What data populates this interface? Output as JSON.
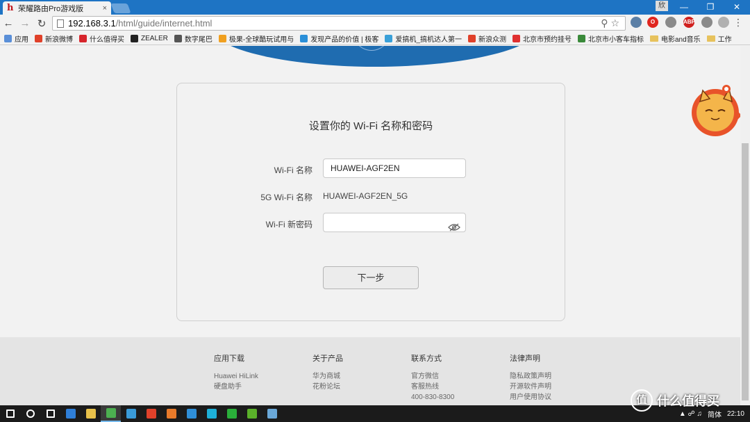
{
  "browser": {
    "tab_title": "荣耀路由Pro游戏版",
    "tab_close": "×",
    "profile_label": "欣",
    "window_controls": [
      "—",
      "❐",
      "✕"
    ],
    "url_host": "192.168.3.1",
    "url_path": "/html/guide/internet.html",
    "extensions": [
      {
        "name": "ext-translate",
        "label": "",
        "color": "#5b7fa6"
      },
      {
        "name": "ext-opera",
        "label": "O",
        "color": "#e0261f"
      },
      {
        "name": "ext-chrome",
        "label": "",
        "color": "#8a8a8a"
      },
      {
        "name": "ext-abp",
        "label": "ABP",
        "color": "#d0201e"
      },
      {
        "name": "ext-gray",
        "label": "",
        "color": "#8a8a8a"
      },
      {
        "name": "ext-feather",
        "label": "",
        "color": "#b0b0b0"
      }
    ]
  },
  "bookmarks": [
    {
      "label": "应用",
      "color": "#5a8fd8"
    },
    {
      "label": "新浪微博",
      "color": "#e0412a"
    },
    {
      "label": "什么值得买",
      "color": "#d7252c"
    },
    {
      "label": "ZEALER",
      "color": "#222222"
    },
    {
      "label": "数字尾巴",
      "color": "#555555"
    },
    {
      "label": "极果-全球酷玩试用与",
      "color": "#f0a020"
    },
    {
      "label": "发现产品的价值 | 极客",
      "color": "#2a8fd8"
    },
    {
      "label": "爱搞机_搞机达人第一",
      "color": "#3aa0d8"
    },
    {
      "label": "新浪众测",
      "color": "#e0412a"
    },
    {
      "label": "北京市预约挂号",
      "color": "#e03030"
    },
    {
      "label": "北京市小客车指标",
      "color": "#3a8a3a"
    },
    {
      "label": "电影and音乐",
      "color": "folder"
    },
    {
      "label": "工作",
      "color": "folder"
    }
  ],
  "form": {
    "title": "设置你的 Wi-Fi 名称和密码",
    "wifi_name_label": "Wi-Fi 名称",
    "wifi_name_value": "HUAWEI-AGF2EN",
    "wifi5g_label": "5G Wi-Fi 名称",
    "wifi5g_value": "HUAWEI-AGF2EN_5G",
    "password_label": "Wi-Fi 新密码",
    "password_value": "",
    "next_button": "下一步"
  },
  "footer": [
    {
      "heading": "应用下载",
      "links": [
        "Huawei HiLink",
        "硬盘助手"
      ]
    },
    {
      "heading": "关于产品",
      "links": [
        "华为商城",
        "花粉论坛"
      ]
    },
    {
      "heading": "联系方式",
      "links": [
        "官方微信",
        "客服热线",
        "400-830-8300"
      ]
    },
    {
      "heading": "法律声明",
      "links": [
        "隐私政策声明",
        "开源软件声明",
        "用户使用协议"
      ]
    }
  ],
  "taskbar": {
    "ime_label": "简体",
    "clock": "22:10",
    "apps": [
      {
        "name": "start-icon",
        "color": "#ffffff"
      },
      {
        "name": "search-icon",
        "color": "#ffffff"
      },
      {
        "name": "task-view-icon",
        "color": "#ffffff"
      },
      {
        "name": "edge-icon",
        "color": "#2f7fd8"
      },
      {
        "name": "explorer-icon",
        "color": "#e8c14a"
      },
      {
        "name": "chrome-icon",
        "color": "#4caf50"
      },
      {
        "name": "app-bird-icon",
        "color": "#3a9bd8"
      },
      {
        "name": "weibo-icon",
        "color": "#e0412a"
      },
      {
        "name": "app-orange-icon",
        "color": "#e87a2a"
      },
      {
        "name": "app-blue-icon",
        "color": "#2f8fd8"
      },
      {
        "name": "app-cyan-icon",
        "color": "#1eb0d8"
      },
      {
        "name": "wechat-icon",
        "color": "#2aae3a"
      },
      {
        "name": "app-green-icon",
        "color": "#5ab02a"
      },
      {
        "name": "app-map-icon",
        "color": "#6aa8d8"
      }
    ]
  },
  "watermark": {
    "symbol": "值",
    "text": "什么值得买"
  }
}
